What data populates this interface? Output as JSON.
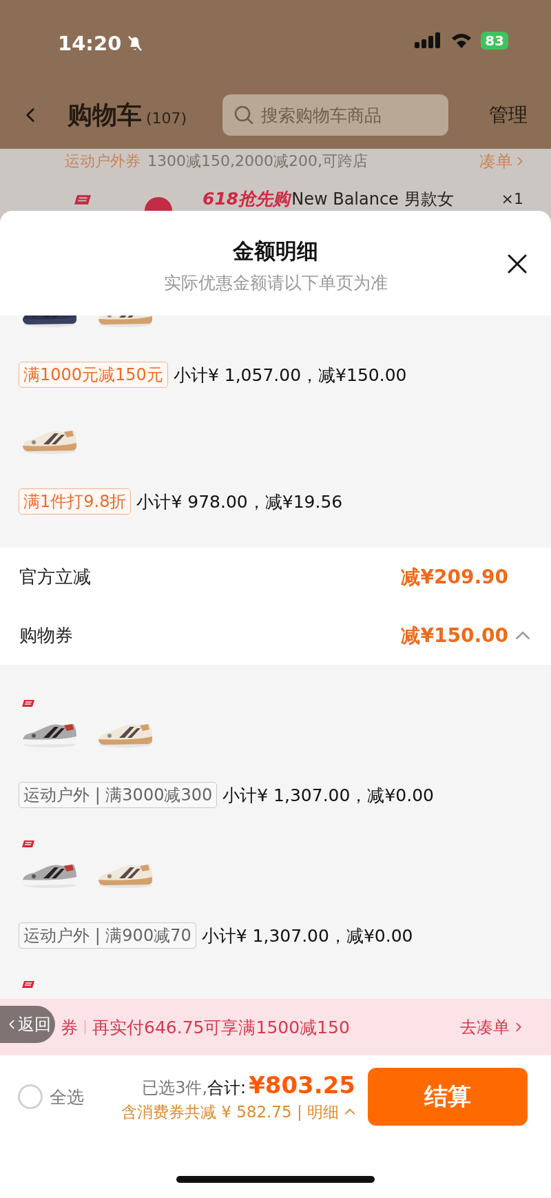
{
  "status_bar": {
    "time": "14:20",
    "battery": "83"
  },
  "header": {
    "title": "购物车",
    "count": "(107)",
    "search": {
      "placeholder": "搜索购物车商品"
    },
    "manage": "管理"
  },
  "coupon_bar": {
    "label": "运动户外券",
    "text": "1300减150,2000减200,可跨店",
    "link": "凑单"
  },
  "cart_item": {
    "promo": "618抢先购",
    "name": "New Balance 男款女",
    "qty": "×1"
  },
  "sheet": {
    "title": "金额明细",
    "subtitle": "实际优惠金额请以下单页为准",
    "upper_groups": [
      {
        "tag": {
          "kind": "promo",
          "text": "满1000元减150元"
        },
        "summary": "小计¥ 1,057.00，减¥150.00"
      },
      {
        "tag": {
          "kind": "promo",
          "text": "满1件打9.8折"
        },
        "summary": "小计¥ 978.00，减¥19.56"
      }
    ],
    "discounts": [
      {
        "label": "官方立减",
        "amount": "减¥209.90"
      },
      {
        "label": "购物券",
        "amount": "减¥150.00",
        "expanded": true
      }
    ],
    "lower_groups": [
      {
        "logo": true,
        "tag": {
          "kind": "coupon",
          "text": "运动户外 | 满3000减300"
        },
        "summary": "小计¥ 1,307.00，减¥0.00"
      },
      {
        "logo": true,
        "tag": {
          "kind": "coupon",
          "text": "运动户外 | 满900减70"
        },
        "summary": "小计¥ 1,307.00，减¥0.00"
      },
      {
        "logo": true
      }
    ]
  },
  "banner": {
    "back": "返回",
    "tag": "券",
    "text": "再实付646.75可享满1500减150",
    "link": "去凑单"
  },
  "checkout": {
    "select_all": {
      "label": "全选",
      "checked": false
    },
    "selected": "已选3件,",
    "total_label": "合计:",
    "total": "¥803.25",
    "savings": "含消费券共减 ¥ 582.75 | 明细",
    "button": "结算"
  }
}
